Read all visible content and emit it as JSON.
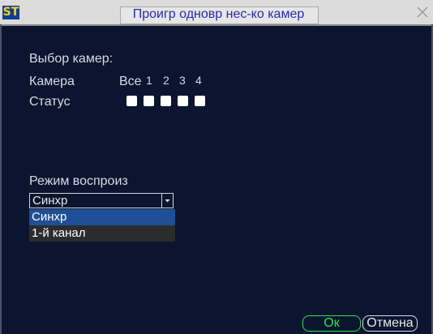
{
  "window": {
    "logo": "ST",
    "title": "Проигр одновр нес-ко камер",
    "close_icon": "close-icon"
  },
  "form": {
    "camera_select_label": "Выбор камер:",
    "camera_label": "Камера",
    "all_label": "Все",
    "camera_numbers": [
      "1",
      "2",
      "3",
      "4"
    ],
    "status_label": "Статус",
    "playback_mode_label": "Режим воспроиз",
    "playback_mode_value": "Синхр",
    "playback_mode_options": [
      "Синхр",
      "1-й канал"
    ]
  },
  "buttons": {
    "ok": "Ок",
    "cancel": "Отмена"
  },
  "colors": {
    "background": "#0c1530",
    "ok_text": "#2ee04b",
    "selected_option": "#1f4f96"
  }
}
